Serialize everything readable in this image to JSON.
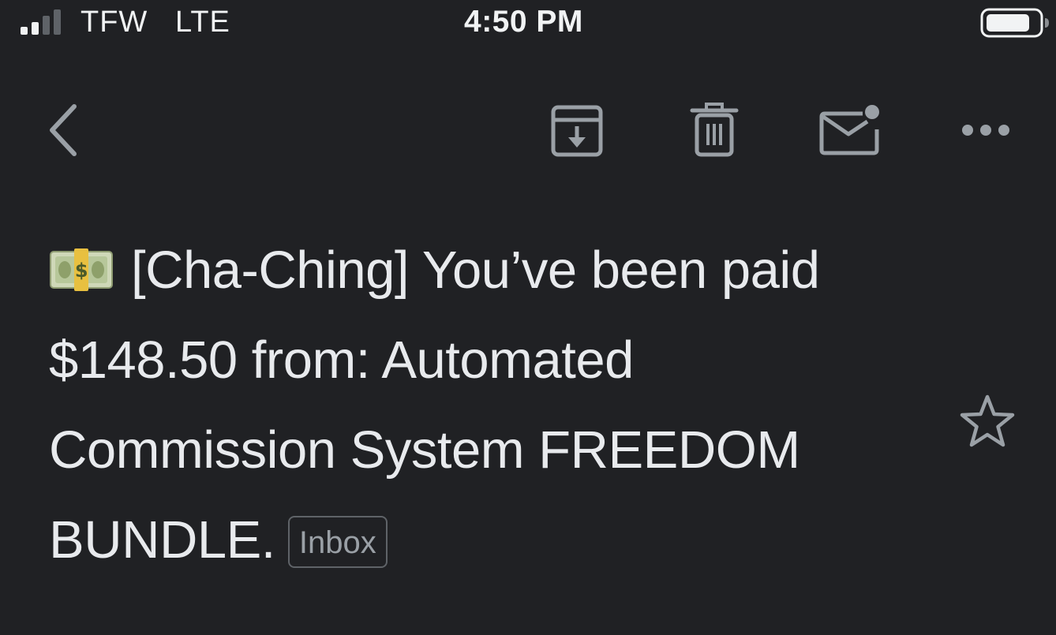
{
  "status_bar": {
    "carrier": "TFW",
    "network": "LTE",
    "time": "4:50 PM"
  },
  "toolbar": {
    "icons": [
      "back-arrow-icon",
      "archive-icon",
      "trash-icon",
      "mark-unread-icon",
      "more-options-icon"
    ]
  },
  "email": {
    "subject_emoji": "money-with-wings-banknote-icon",
    "subject": "[Cha-Ching] You’ve been paid $148.50 from: Automated Commission System FREEDOM BUNDLE.",
    "label": "Inbox",
    "starred": false
  },
  "colors": {
    "background": "#202124",
    "text": "#e8eaed",
    "icon": "#9aa0a6",
    "chip_border": "#5f6368"
  }
}
